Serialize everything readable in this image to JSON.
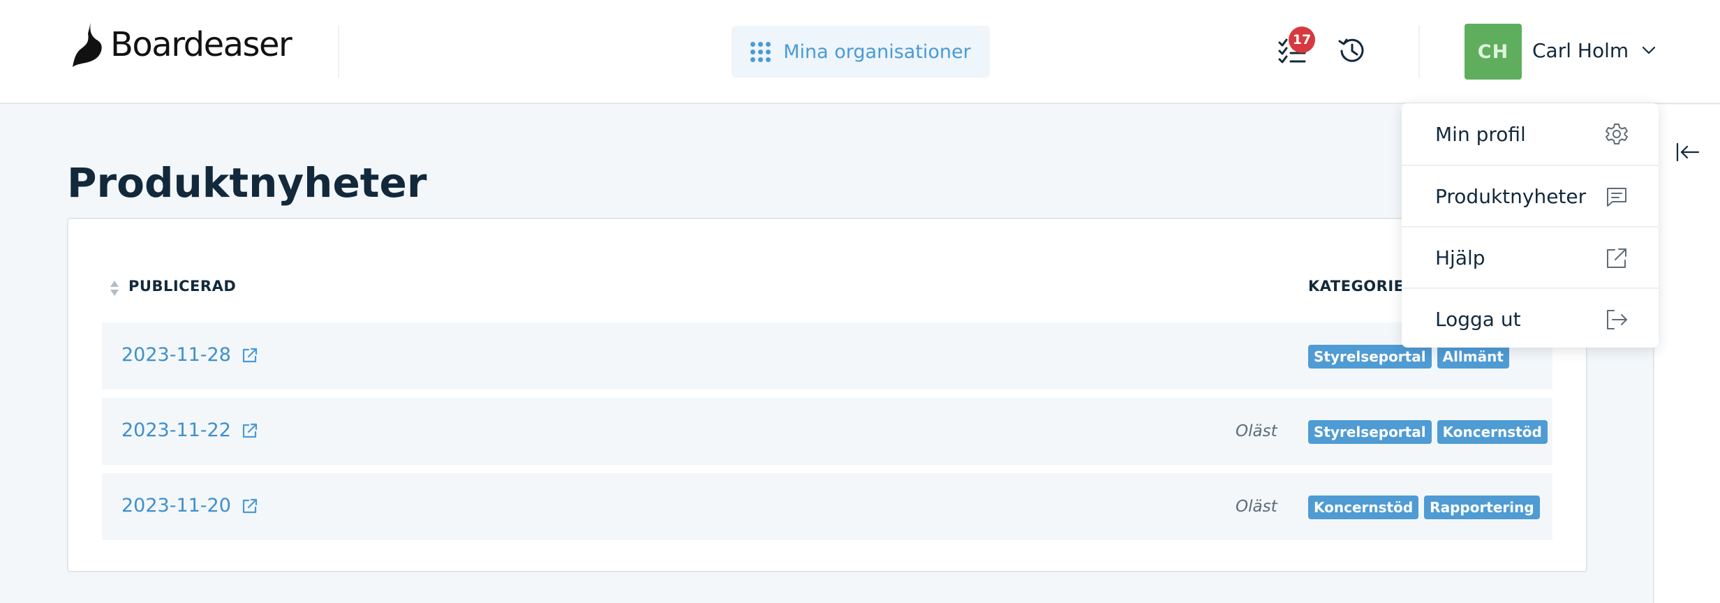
{
  "header": {
    "logo_text": "Boardeaser",
    "org_button_label": "Mina organisationer",
    "tasks_badge": "17",
    "user": {
      "initials": "CH",
      "name": "Carl Holm",
      "avatar_color": "#5fae5e"
    }
  },
  "page": {
    "title": "Produktnyheter",
    "columns": {
      "published": "PUBLICERAD",
      "category": "KATEGORIE"
    },
    "rows": [
      {
        "date": "2023-11-28",
        "status": "",
        "tags": [
          "Styrelseportal",
          "Allmänt"
        ]
      },
      {
        "date": "2023-11-22",
        "status": "Oläst",
        "tags": [
          "Styrelseportal",
          "Koncernstöd"
        ]
      },
      {
        "date": "2023-11-20",
        "status": "Oläst",
        "tags": [
          "Koncernstöd",
          "Rapportering"
        ]
      }
    ]
  },
  "user_menu": {
    "items": [
      {
        "label": "Min profil",
        "icon": "gear-icon"
      },
      {
        "label": "Produktnyheter",
        "icon": "message-icon"
      },
      {
        "label": "Hjälp",
        "icon": "external-link-icon"
      },
      {
        "label": "Logga ut",
        "icon": "logout-icon"
      }
    ]
  },
  "colors": {
    "accent": "#4a9ad4",
    "tag": "#4f9bd4",
    "badge": "#d6393f",
    "text": "#12293b"
  }
}
